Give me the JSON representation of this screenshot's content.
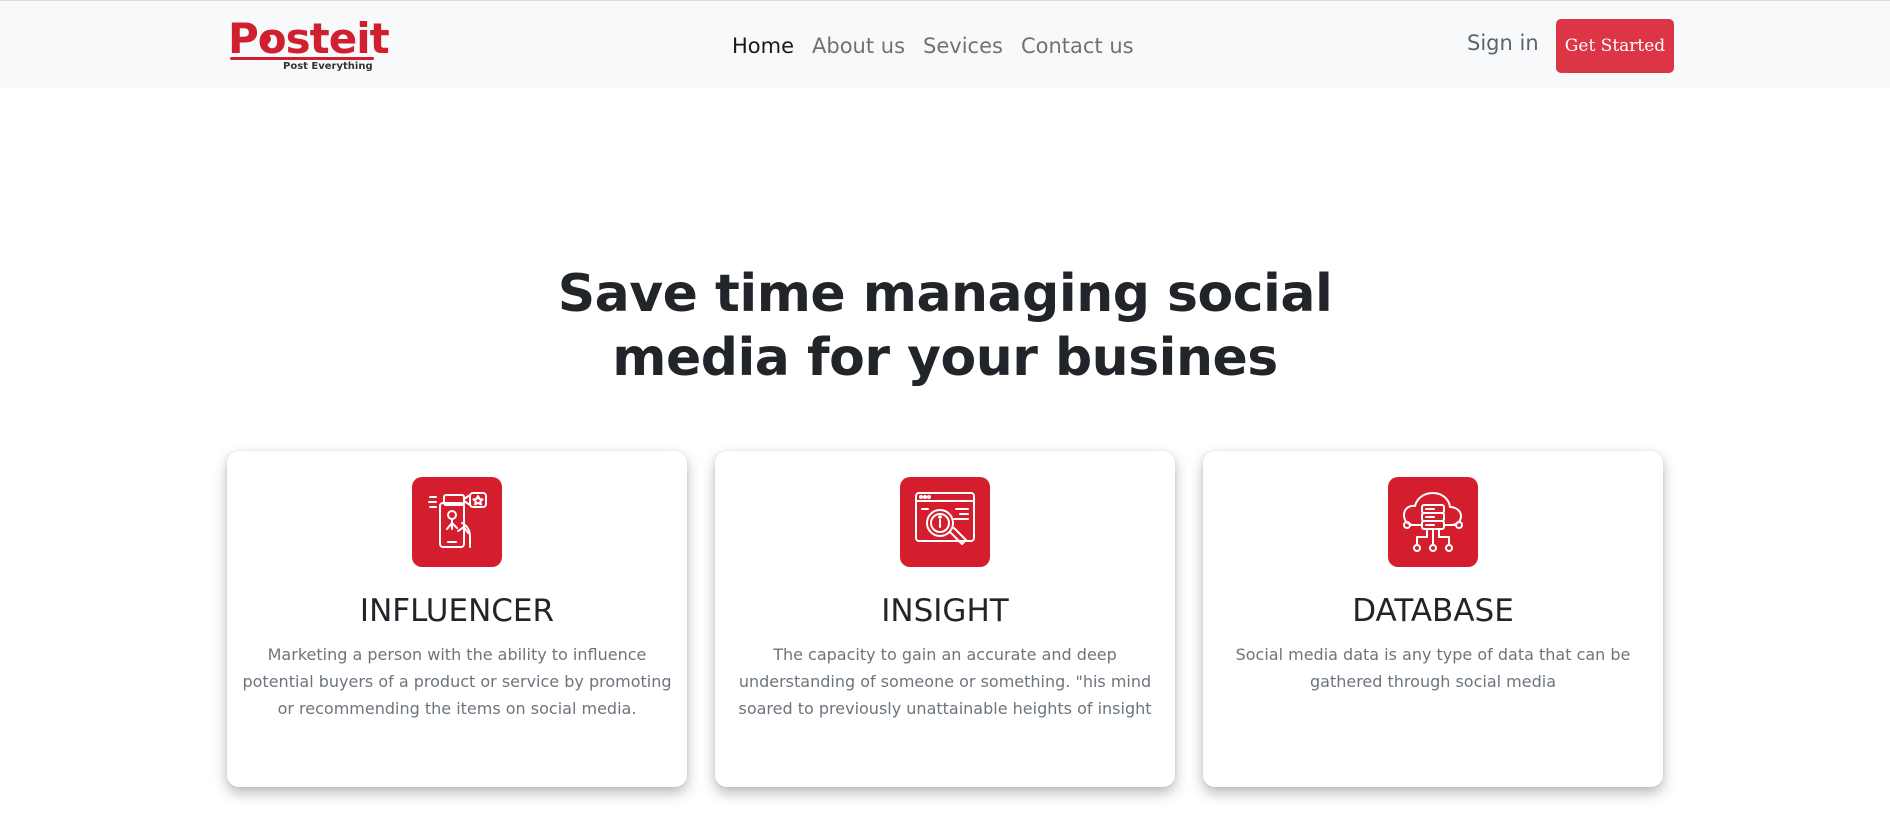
{
  "brand": {
    "logo_text": "Posteit",
    "tagline": "Post Everything",
    "color": "#d0202f"
  },
  "nav": {
    "links": [
      {
        "label": "Home",
        "active": true
      },
      {
        "label": "About us",
        "active": false
      },
      {
        "label": "Sevices",
        "active": false
      },
      {
        "label": "Contact us",
        "active": false
      }
    ],
    "sign_in": "Sign in",
    "cta": "Get Started",
    "cta_color": "#dc3545"
  },
  "hero": {
    "title_line1": "Save time managing social",
    "title_line2": "media for your busines"
  },
  "cards": [
    {
      "icon": "influencer-icon",
      "title": "INFLUENCER",
      "text": "Marketing a person with the ability to influence potential buyers of a product or service by promoting or recommending the items on social media."
    },
    {
      "icon": "insight-icon",
      "title": "INSIGHT",
      "text": "The capacity to gain an accurate and deep understanding of someone or something. \"his mind soared to previously unattainable heights of insight"
    },
    {
      "icon": "database-icon",
      "title": "DATABASE",
      "text": "Social media data is any type of data that can be gathered through social media"
    }
  ],
  "accent_color": "#d41e2e"
}
